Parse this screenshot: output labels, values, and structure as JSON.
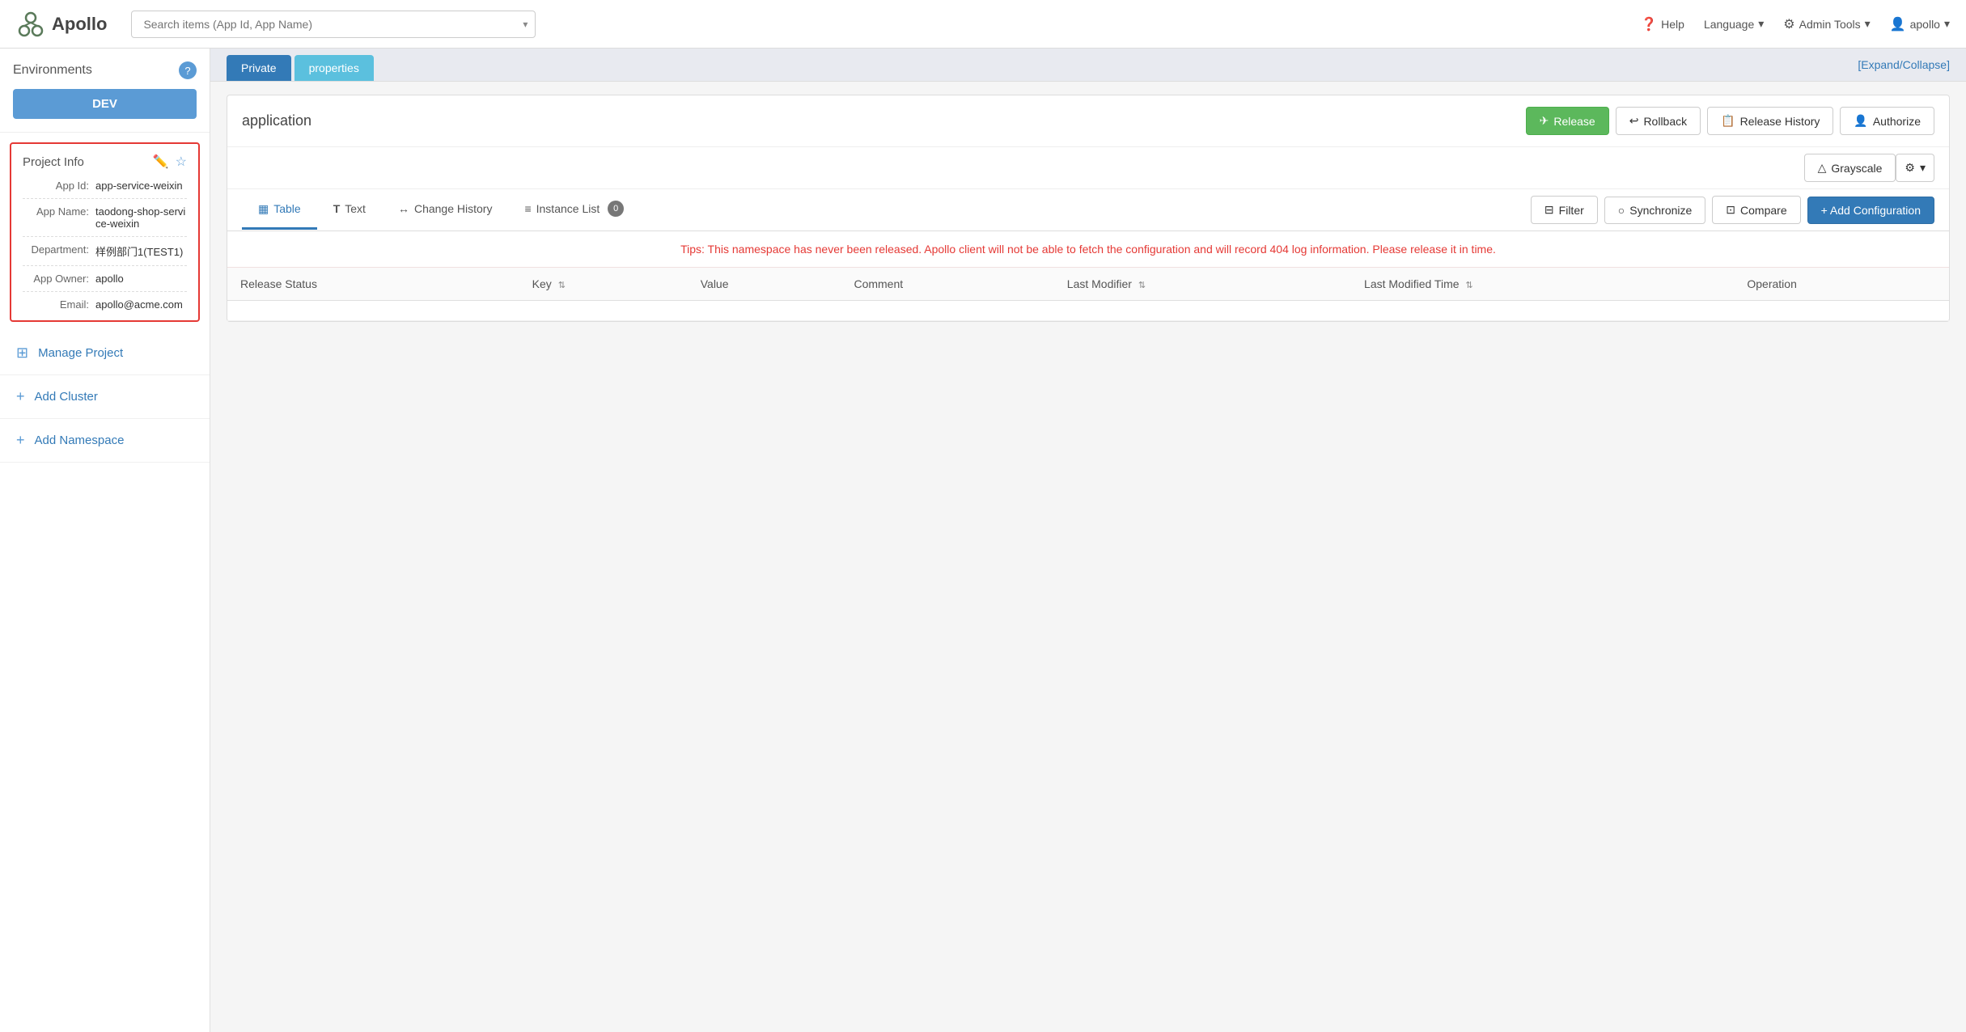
{
  "topNav": {
    "logoText": "Apollo",
    "searchPlaceholder": "Search items (App Id, App Name)",
    "navItems": [
      {
        "label": "Help",
        "icon": "❓",
        "name": "help-nav"
      },
      {
        "label": "Language",
        "icon": "",
        "dropdown": true,
        "name": "language-nav"
      },
      {
        "label": "Admin Tools",
        "icon": "⚙️",
        "dropdown": true,
        "name": "admin-tools-nav"
      },
      {
        "label": "apollo",
        "icon": "👤",
        "dropdown": true,
        "name": "user-nav"
      }
    ]
  },
  "sidebar": {
    "environmentsLabel": "Environments",
    "currentEnv": "DEV",
    "projectInfo": {
      "title": "Project Info",
      "fields": [
        {
          "key": "App Id:",
          "value": "app-service-weixin"
        },
        {
          "key": "App Name:",
          "value": "taodong-shop-service-weixin"
        },
        {
          "key": "Department:",
          "value": "样例部门1(TEST1)"
        },
        {
          "key": "App Owner:",
          "value": "apollo"
        },
        {
          "key": "Email:",
          "value": "apollo@acme.com"
        }
      ]
    },
    "navItems": [
      {
        "icon": "⊞",
        "label": "Manage Project",
        "name": "manage-project"
      },
      {
        "icon": "+",
        "label": "Add Cluster",
        "name": "add-cluster"
      },
      {
        "icon": "+",
        "label": "Add Namespace",
        "name": "add-namespace"
      }
    ]
  },
  "namespaceTabs": [
    {
      "label": "Private",
      "style": "private"
    },
    {
      "label": "properties",
      "style": "properties"
    }
  ],
  "expandCollapseLabel": "[Expand/Collapse]",
  "panel": {
    "title": "application",
    "buttons": {
      "release": "Release",
      "rollback": "Rollback",
      "releaseHistory": "Release History",
      "authorize": "Authorize",
      "grayscale": "Grayscale"
    },
    "innerTabs": [
      {
        "label": "Table",
        "icon": "▦",
        "active": true,
        "name": "tab-table"
      },
      {
        "label": "Text",
        "icon": "T",
        "name": "tab-text"
      },
      {
        "label": "Change History",
        "icon": "↔",
        "name": "tab-change-history"
      },
      {
        "label": "Instance List",
        "icon": "≡",
        "badge": "0",
        "name": "tab-instance-list"
      }
    ],
    "actionButtons": {
      "filter": "Filter",
      "synchronize": "Synchronize",
      "compare": "Compare",
      "addConfiguration": "+ Add Configuration"
    },
    "tipWarning": "Tips: This namespace has never been released. Apollo client will not be able to fetch the configuration and will record 404 log information. Please release it in time.",
    "tableColumns": [
      {
        "label": "Release Status",
        "sortable": false
      },
      {
        "label": "Key",
        "sortable": true
      },
      {
        "label": "Value",
        "sortable": false
      },
      {
        "label": "Comment",
        "sortable": false
      },
      {
        "label": "Last Modifier",
        "sortable": true
      },
      {
        "label": "Last Modified Time",
        "sortable": true
      },
      {
        "label": "Operation",
        "sortable": false
      }
    ],
    "tableRows": []
  }
}
